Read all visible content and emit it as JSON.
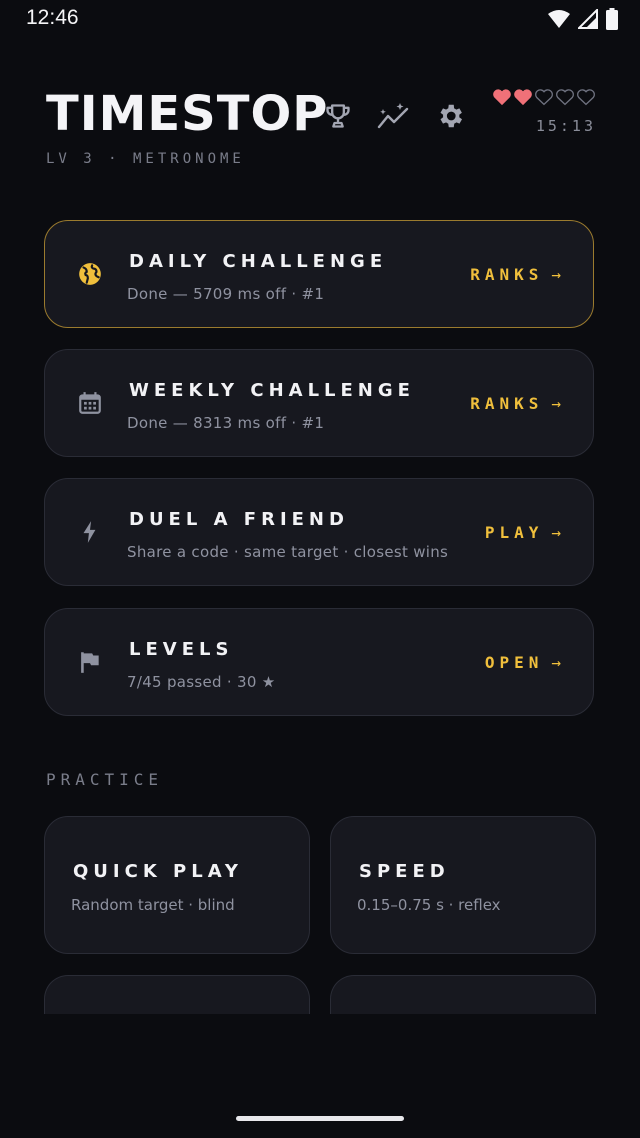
{
  "status_bar": {
    "time": "12:46"
  },
  "header": {
    "title": "TIMESTOP",
    "subtitle": "LV 3 · METRONOME",
    "timer": "15:13",
    "hearts": {
      "filled": 2,
      "total": 5,
      "color": "#f07178"
    },
    "icons": [
      "trophy-icon",
      "stats-icon",
      "settings-icon"
    ]
  },
  "cards": [
    {
      "title": "DAILY CHALLENGE",
      "subtitle": "Done — 5709 ms off · #1",
      "action": "RANKS",
      "icon": "globe-icon",
      "highlight": true
    },
    {
      "title": "WEEKLY CHALLENGE",
      "subtitle": "Done — 8313 ms off · #1",
      "action": "RANKS",
      "icon": "calendar-icon",
      "highlight": false
    },
    {
      "title": "DUEL A FRIEND",
      "subtitle": "Share a code · same target · closest wins",
      "action": "PLAY",
      "icon": "bolt-icon",
      "highlight": false
    },
    {
      "title": "LEVELS",
      "subtitle": "7/45 passed · 30 ★",
      "action": "OPEN",
      "icon": "flag-icon",
      "highlight": false
    }
  ],
  "arrow": "→",
  "practice": {
    "label": "PRACTICE",
    "tiles": [
      {
        "title": "QUICK PLAY",
        "subtitle": "Random target · blind"
      },
      {
        "title": "SPEED",
        "subtitle": "0.15–0.75 s · reflex"
      }
    ]
  },
  "colors": {
    "accent": "#f0bf3c",
    "background": "#0b0c10",
    "card": "#17181f",
    "highlight_border": "#9b7b2e"
  }
}
